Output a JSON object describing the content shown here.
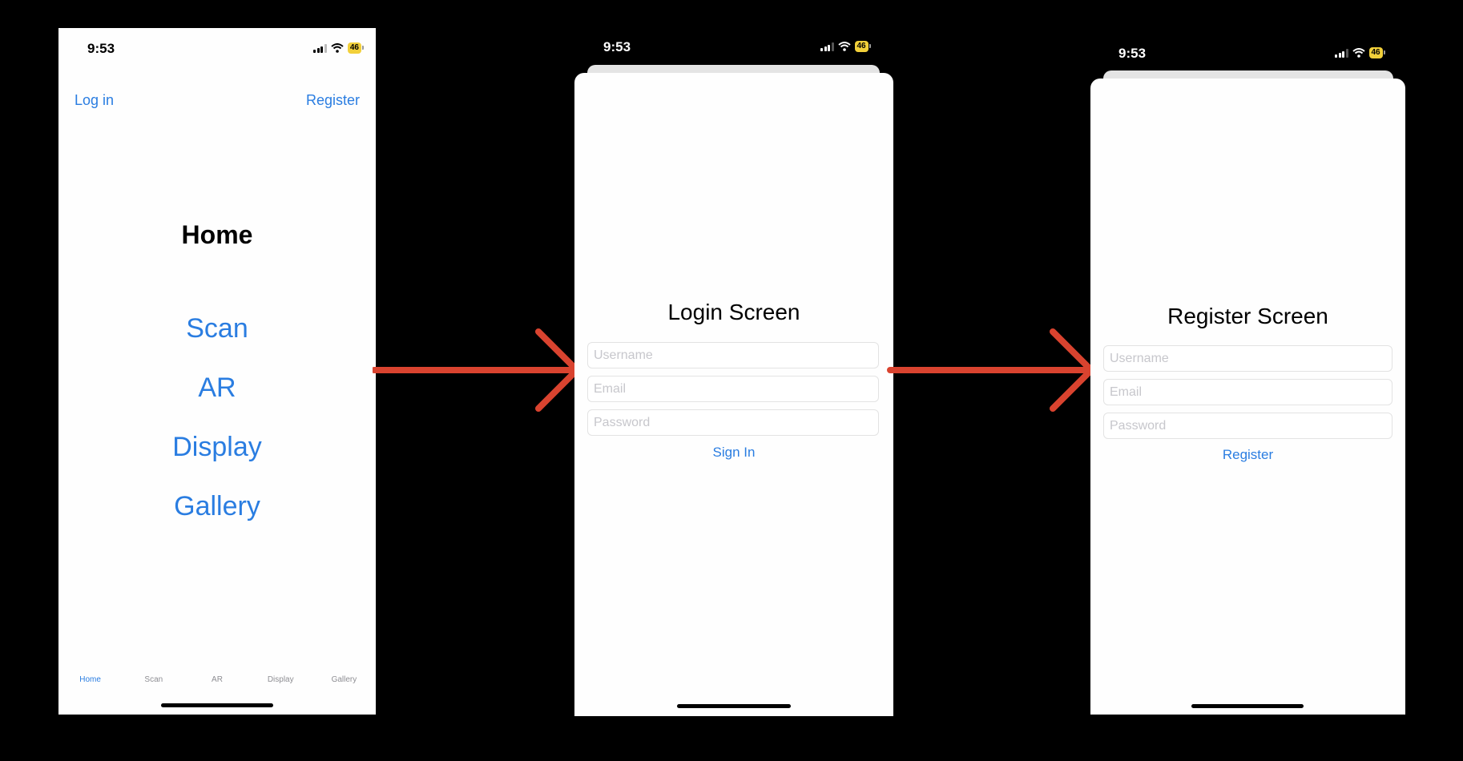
{
  "status_bar": {
    "time": "9:53",
    "battery": "46"
  },
  "home_screen": {
    "nav": {
      "login": "Log in",
      "register": "Register"
    },
    "title": "Home",
    "menu": [
      "Scan",
      "AR",
      "Display",
      "Gallery"
    ],
    "tabs": [
      {
        "label": "Home",
        "active": true
      },
      {
        "label": "Scan",
        "active": false
      },
      {
        "label": "AR",
        "active": false
      },
      {
        "label": "Display",
        "active": false
      },
      {
        "label": "Gallery",
        "active": false
      }
    ]
  },
  "login_screen": {
    "title": "Login Screen",
    "username_placeholder": "Username",
    "email_placeholder": "Email",
    "password_placeholder": "Password",
    "submit_label": "Sign In"
  },
  "register_screen": {
    "title": "Register Screen",
    "username_placeholder": "Username",
    "email_placeholder": "Email",
    "password_placeholder": "Password",
    "submit_label": "Register"
  },
  "colors": {
    "accent": "#2a7de1",
    "arrow": "#d9432f",
    "battery": "#f2d03a",
    "backdrop": "#000000"
  },
  "icons": [
    "signal-icon",
    "wifi-icon",
    "battery-icon",
    "arrow-right-icon"
  ]
}
